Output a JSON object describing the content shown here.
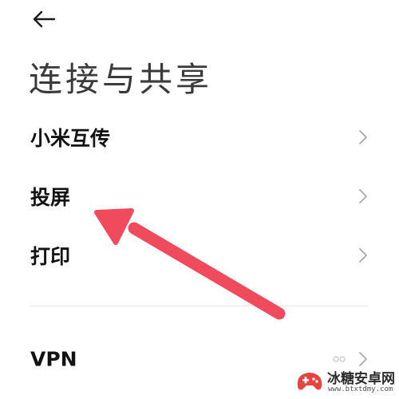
{
  "header": {
    "back_icon": "back-arrow-icon",
    "title": "连接与共享"
  },
  "items": [
    {
      "label": "小米互传",
      "icon": "chevron-right-icon"
    },
    {
      "label": "投屏",
      "icon": "chevron-right-icon"
    },
    {
      "label": "打印",
      "icon": "chevron-right-icon"
    },
    {
      "label": "VPN",
      "icon": "chevron-right-icon",
      "status_icon": "link-icon"
    }
  ],
  "annotation": {
    "color": "#f04b5d",
    "points_to": "投屏"
  },
  "watermark": {
    "name": "冰糖安卓网",
    "url": "www.btxtdmy.com"
  }
}
